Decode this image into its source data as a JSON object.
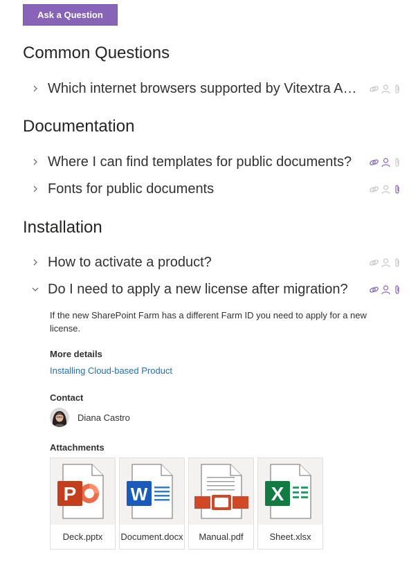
{
  "ask_button": {
    "label": "Ask a Question"
  },
  "sections": [
    {
      "title": "Common Questions",
      "questions": [
        {
          "text": "Which internet browsers supported by Vitextra Apps?",
          "expanded": false,
          "icons": {
            "link": "inactive",
            "person": "inactive",
            "attachment": "inactive"
          }
        }
      ]
    },
    {
      "title": "Documentation",
      "questions": [
        {
          "text": "Where I can find templates for public documents?",
          "expanded": false,
          "icons": {
            "link": "active",
            "person": "active",
            "attachment": "inactive"
          }
        },
        {
          "text": "Fonts for public documents",
          "expanded": false,
          "icons": {
            "link": "inactive",
            "person": "inactive",
            "attachment": "active"
          }
        }
      ]
    },
    {
      "title": "Installation",
      "questions": [
        {
          "text": "How to activate a product?",
          "expanded": false,
          "icons": {
            "link": "inactive",
            "person": "inactive",
            "attachment": "inactive"
          }
        },
        {
          "text": "Do I need to apply a new license after migration?",
          "expanded": true,
          "icons": {
            "link": "active",
            "person": "active",
            "attachment": "active"
          }
        }
      ]
    }
  ],
  "answer": {
    "text": "If the new SharePoint Farm has a different Farm ID you need to apply for a new license.",
    "more_details_label": "More details",
    "more_details_link": "Installing Cloud-based Product",
    "contact_label": "Contact",
    "contact_name": "Diana Castro",
    "attachments_label": "Attachments",
    "attachments": [
      {
        "name": "Deck.pptx",
        "type": "pptx-icon"
      },
      {
        "name": "Document.docx",
        "type": "docx-icon"
      },
      {
        "name": "Manual.pdf",
        "type": "pdf-icon"
      },
      {
        "name": "Sheet.xlsx",
        "type": "xlsx-icon"
      }
    ]
  },
  "colors": {
    "accent": "#8764b8",
    "icon_active": "#8764b8",
    "icon_inactive": "#c8c6c4",
    "link": "#1f6fbf",
    "pptx": "#c43e1c",
    "docx": "#185abd",
    "pdf": "#d24726",
    "xlsx": "#107c41"
  }
}
